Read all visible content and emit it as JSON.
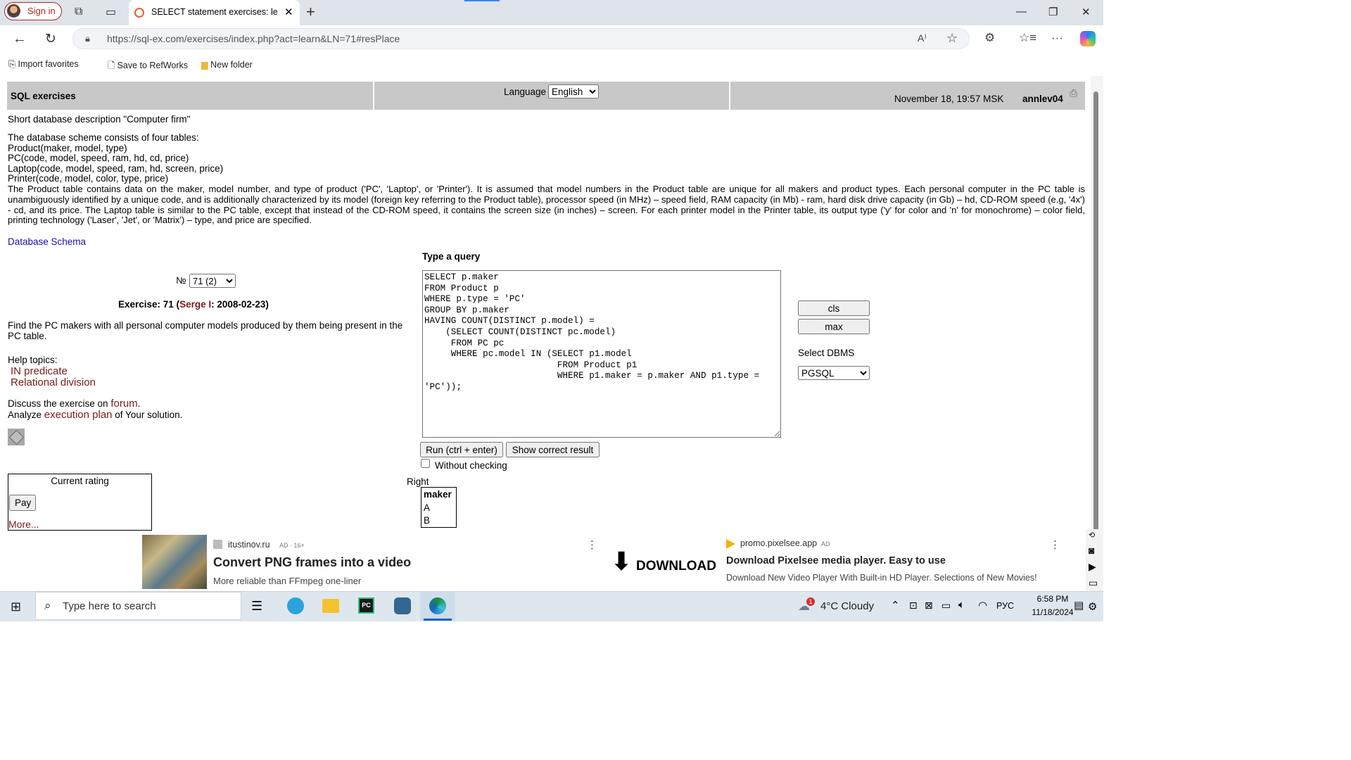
{
  "browser": {
    "signin": "Sign in",
    "tab_title": "SELECT statement exercises: learn",
    "url": "https://sql-ex.com/exercises/index.php?act=learn&LN=71#resPlace",
    "favorites": [
      "Import favorites",
      "Save to RefWorks",
      "New folder"
    ]
  },
  "header": {
    "title": "SQL exercises",
    "language_label": "Language",
    "language_value": "English",
    "datetime": "November 18, 19:57 MSK",
    "username": "annlev04"
  },
  "description": {
    "heading": "Short database description \"Computer firm\"",
    "lines": [
      "The database scheme consists of four tables:",
      "Product(maker, model, type)",
      "PC(code, model, speed, ram, hd, cd, price)",
      "Laptop(code, model, speed, ram, hd, screen, price)",
      "Printer(code, model, color, type, price)"
    ],
    "paragraph": "The Product table contains data on the maker, model number, and type of product ('PC', 'Laptop', or 'Printer'). It is assumed that model numbers in the Product table are unique for all makers and product types. Each personal computer in the PC table is unambiguously identified by a unique code, and is additionally characterized by its model (foreign key referring to the Product table), processor speed (in MHz) – speed field, RAM capacity (in Mb) - ram, hard disk drive capacity (in Gb) – hd, CD-ROM speed (e.g, '4x') - cd, and its price. The Laptop table is similar to the PC table, except that instead of the CD-ROM speed, it contains the screen size (in inches) – screen. For each printer model in the Printer table, its output type ('y' for color and 'n' for monochrome) – color field, printing technology ('Laser', 'Jet', or 'Matrix') – type, and price are specified.",
    "schema_link": "Database Schema"
  },
  "exercise": {
    "number_label": "№",
    "number_value": "71 (2)",
    "title_prefix": "Exercise: 71 (",
    "author": "Serge I",
    "title_suffix": ": 2008-02-23)",
    "task": "Find the PC makers with all personal computer models produced by them being present in the PC table.",
    "help_label": "Help topics:",
    "help_topics": [
      "IN predicate",
      "Relational division"
    ],
    "discuss_prefix": "Discuss the exercise on ",
    "discuss_link": "forum",
    "discuss_suffix": ".",
    "analyze_prefix": "Analyze ",
    "analyze_link": "execution plan",
    "analyze_suffix": " of Your solution."
  },
  "rating": {
    "title": "Current rating",
    "pay": "Pay",
    "more": "More..."
  },
  "query": {
    "label": "Type a query",
    "text": "SELECT p.maker\nFROM Product p\nWHERE p.type = 'PC'\nGROUP BY p.maker\nHAVING COUNT(DISTINCT p.model) =\n    (SELECT COUNT(DISTINCT pc.model)\n     FROM PC pc\n     WHERE pc.model IN (SELECT p1.model\n                         FROM Product p1\n                         WHERE p1.maker = p.maker AND p1.type =\n'PC'));",
    "run": "Run (ctrl + enter)",
    "show_correct": "Show correct result",
    "without_checking": "Without checking",
    "cls": "cls",
    "max": "max",
    "dbms_label": "Select DBMS",
    "dbms_value": "PGSQL"
  },
  "result": {
    "status": "Right",
    "column": "maker",
    "rows": [
      "A",
      "B"
    ]
  },
  "ads": [
    {
      "site": "itustinov.ru",
      "tag": "AD · 16+",
      "title": "Convert PNG frames into a video",
      "desc": "More reliable than FFmpeg one-liner"
    },
    {
      "site": "promo.pixelsee.app",
      "tag": "AD",
      "image_text": "DOWNLOAD",
      "title": "Download Pixelsee media player. Easy to use",
      "desc": "Download New Video Player With Built-in HD Player. Selections of New Movies!"
    }
  ],
  "taskbar": {
    "search_placeholder": "Type here to search",
    "weather": "4°C  Cloudy",
    "lang": "РУС",
    "time": "6:58 PM",
    "date": "11/18/2024",
    "badge": "1"
  }
}
